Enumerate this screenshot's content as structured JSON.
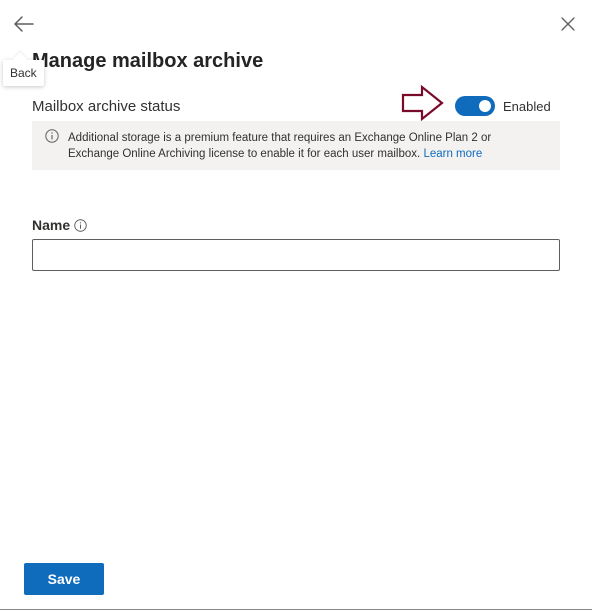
{
  "header": {
    "title": "Manage mailbox archive",
    "back_tooltip": "Back",
    "icons": {
      "back": "arrow-left-icon",
      "close": "close-icon"
    }
  },
  "archive_status": {
    "label": "Mailbox archive status",
    "toggle_on": true,
    "toggle_state_text": "Enabled",
    "annotation_icon": "outlined-arrow-right-icon"
  },
  "info_bar": {
    "icon": "info-icon",
    "text": "Additional storage is a premium feature that requires an Exchange Online Plan 2 or Exchange Online Archiving license to enable it for each user mailbox.",
    "link_text": "Learn more"
  },
  "name_field": {
    "label": "Name",
    "info_icon": "info-icon",
    "value": "",
    "placeholder": ""
  },
  "footer": {
    "save_label": "Save"
  },
  "colors": {
    "accent": "#0f6cbd",
    "info_bar_bg": "#f3f2f1",
    "annotation_arrow": "#7a0a2a"
  }
}
